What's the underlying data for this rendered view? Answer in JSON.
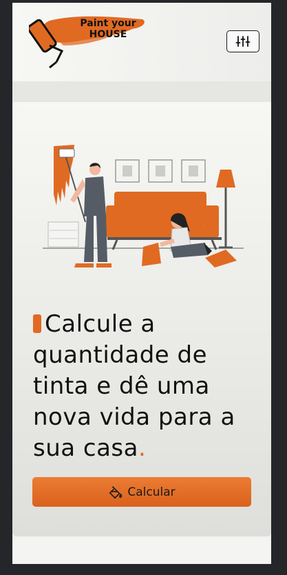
{
  "app": {
    "logo_line1": "Paint your",
    "logo_line2": "HOUSE"
  },
  "header": {
    "menu_icon": "sliders-icon"
  },
  "hero": {
    "headline_main": "Calcule a quantidade de tinta e dê uma nova vida para a sua casa",
    "headline_end": "."
  },
  "actions": {
    "calculate_label": "Calcular",
    "calculate_icon": "paint-bucket-icon"
  },
  "colors": {
    "accent": "#e06a22",
    "dark": "#111111",
    "background": "#25262a"
  }
}
